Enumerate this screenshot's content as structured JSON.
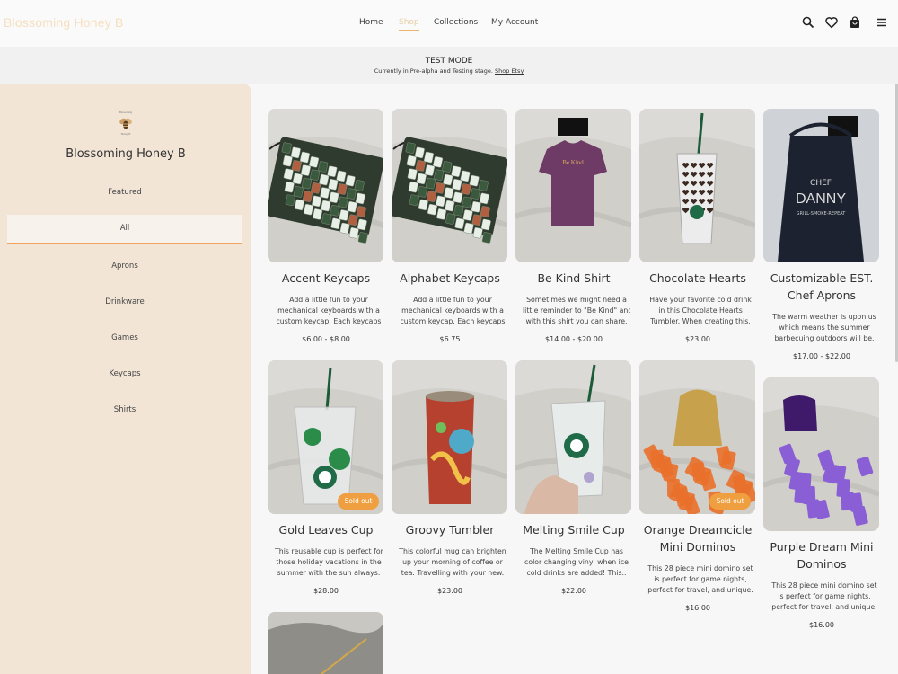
{
  "header": {
    "brand": "Blossoming Honey B",
    "nav": [
      "Home",
      "Shop",
      "Collections",
      "My Account"
    ],
    "active_nav": "Shop"
  },
  "banner": {
    "title": "TEST MODE",
    "subtitle": "Currently in Pre-alpha and Testing stage.",
    "link": "Shop Etsy"
  },
  "sidebar": {
    "shop_name": "Blossoming Honey B",
    "categories": [
      "Featured",
      "All",
      "Aprons",
      "Drinkware",
      "Games",
      "Keycaps",
      "Shirts"
    ],
    "active": "All"
  },
  "products": [
    {
      "title": "Accent Keycaps",
      "desc": [
        "Add a little fun to your",
        "mechanical keyboards with a",
        "custom keycap. Each keycaps"
      ],
      "price": "$6.00 - $8.00",
      "image": "keyboard",
      "sold_out": false
    },
    {
      "title": "Alphabet Keycaps",
      "desc": [
        "Add a little fun to your",
        "mechanical keyboards with a",
        "custom keycap. Each keycaps"
      ],
      "price": "$6.75",
      "image": "keyboard",
      "sold_out": false
    },
    {
      "title": "Be Kind Shirt",
      "desc": [
        "Sometimes we might need a",
        "little reminder to \"Be Kind\" and",
        "with this shirt you can share."
      ],
      "price": "$14.00 - $20.00",
      "image": "shirt",
      "sold_out": false
    },
    {
      "title": "Chocolate Hearts",
      "desc": [
        "Have your favorite cold drink",
        "in this Chocolate Hearts",
        "Tumbler. When creating this,"
      ],
      "price": "$23.00",
      "image": "hearts-cup",
      "sold_out": false
    },
    {
      "title": "Customizable EST. Chef Aprons",
      "title_lines": [
        "Customizable EST.",
        "Chef Aprons"
      ],
      "desc": [
        "The warm weather is upon us",
        "which means the summer",
        "barbecuing outdoors will be."
      ],
      "price": "$17.00 - $22.00",
      "image": "apron",
      "sold_out": false
    },
    {
      "title": "Gold Leaves Cup",
      "desc": [
        "This reusable cup is perfect for",
        "those holiday vacations in the",
        "summer with the sun always."
      ],
      "price": "$28.00",
      "image": "clear-cup",
      "sold_out": true,
      "sold_out_label": "Sold out"
    },
    {
      "title": "Groovy Tumbler",
      "desc": [
        "This colorful mug can brighten",
        "up your morning of coffee or",
        "tea. Travelling with your new."
      ],
      "price": "$23.00",
      "image": "tumbler",
      "sold_out": false
    },
    {
      "title": "Melting Smile Cup",
      "desc": [
        "The Melting Smile Cup has",
        "color changing vinyl when ice",
        "cold drinks are added! This.."
      ],
      "price": "$22.00",
      "image": "smile-cup",
      "sold_out": false
    },
    {
      "title": "Orange Dreamcicle Mini Dominos",
      "title_lines": [
        "Orange Dreamcicle",
        "Mini Dominos"
      ],
      "desc": [
        "This 28 piece mini domino set",
        "is perfect for game nights,",
        "perfect for travel, and unique."
      ],
      "price": "$16.00",
      "image": "orange-dominos",
      "sold_out": true,
      "sold_out_label": "Sold out"
    },
    {
      "title": "Purple Dream Mini Dominos",
      "title_lines": [
        "Purple Dream Mini",
        "Dominos"
      ],
      "desc": [
        "This 28 piece mini domino set",
        "is perfect for game nights,",
        "perfect for travel, and unique."
      ],
      "price": "$16.00",
      "image": "purple-dominos",
      "sold_out": false
    }
  ]
}
